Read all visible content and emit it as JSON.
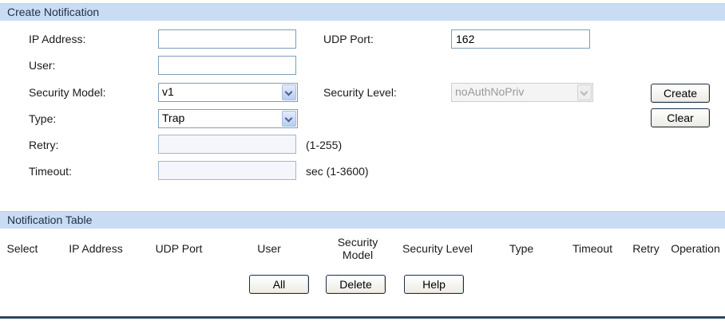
{
  "create_section": {
    "title": "Create Notification",
    "ip_address": {
      "label": "IP Address:",
      "value": ""
    },
    "udp_port": {
      "label": "UDP Port:",
      "value": "162"
    },
    "user": {
      "label": "User:",
      "value": ""
    },
    "security_model": {
      "label": "Security Model:",
      "value": "v1"
    },
    "security_level": {
      "label": "Security Level:",
      "value": "noAuthNoPriv"
    },
    "type": {
      "label": "Type:",
      "value": "Trap"
    },
    "retry": {
      "label": "Retry:",
      "value": "",
      "hint": "(1-255)"
    },
    "timeout": {
      "label": "Timeout:",
      "value": "",
      "hint": "sec (1-3600)"
    },
    "create_button": "Create",
    "clear_button": "Clear"
  },
  "table_section": {
    "title": "Notification Table",
    "columns": [
      "Select",
      "IP Address",
      "UDP Port",
      "User",
      "Security Model",
      "Security Level",
      "Type",
      "Timeout",
      "Retry",
      "Operation"
    ]
  },
  "footer_buttons": {
    "all": "All",
    "delete": "Delete",
    "help": "Help"
  },
  "colors": {
    "header_bg": "#c9dcf4",
    "bottom_line": "#2c4666",
    "input_border": "#7f9db9"
  }
}
